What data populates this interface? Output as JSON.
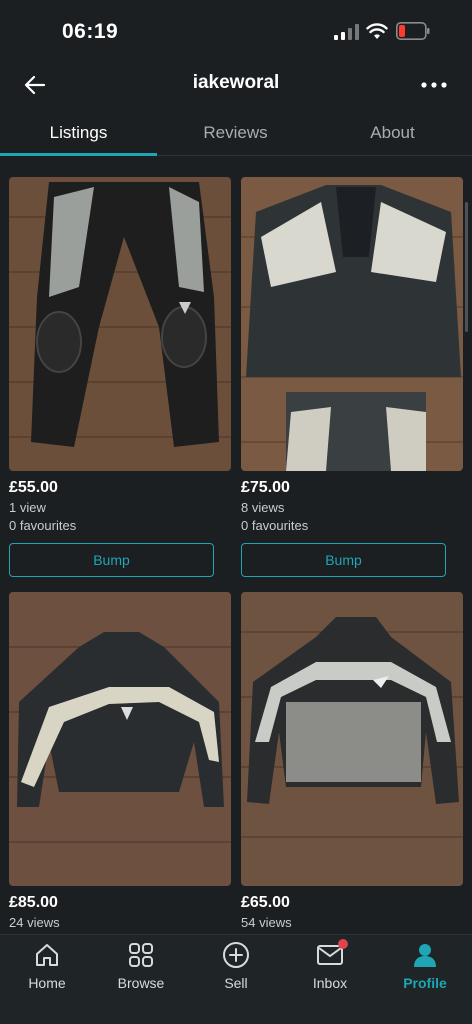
{
  "status": {
    "time": "06:19"
  },
  "header": {
    "title": "iakeworal"
  },
  "tabs": [
    {
      "label": "Listings",
      "active": true
    },
    {
      "label": "Reviews",
      "active": false
    },
    {
      "label": "About",
      "active": false
    }
  ],
  "listings": [
    {
      "price": "£55.00",
      "views": "1 view",
      "favourites": "0 favourites",
      "action": "Bump",
      "item_icon": "leather-trousers"
    },
    {
      "price": "£75.00",
      "views": "8 views",
      "favourites": "0 favourites",
      "action": "Bump",
      "item_icon": "leather-suit"
    },
    {
      "price": "£85.00",
      "views": "24 views",
      "favourites": "",
      "item_icon": "leather-jacket"
    },
    {
      "price": "£65.00",
      "views": "54 views",
      "favourites": "",
      "item_icon": "textile-jacket"
    }
  ],
  "nav": [
    {
      "label": "Home",
      "icon": "home-icon",
      "active": false
    },
    {
      "label": "Browse",
      "icon": "grid-icon",
      "active": false
    },
    {
      "label": "Sell",
      "icon": "plus-circle-icon",
      "active": false
    },
    {
      "label": "Inbox",
      "icon": "mail-icon",
      "active": false,
      "badge": true
    },
    {
      "label": "Profile",
      "icon": "person-icon",
      "active": true
    }
  ],
  "colors": {
    "accent": "#1fa5b3",
    "background": "#1b1f21",
    "badge": "#e0424f"
  }
}
